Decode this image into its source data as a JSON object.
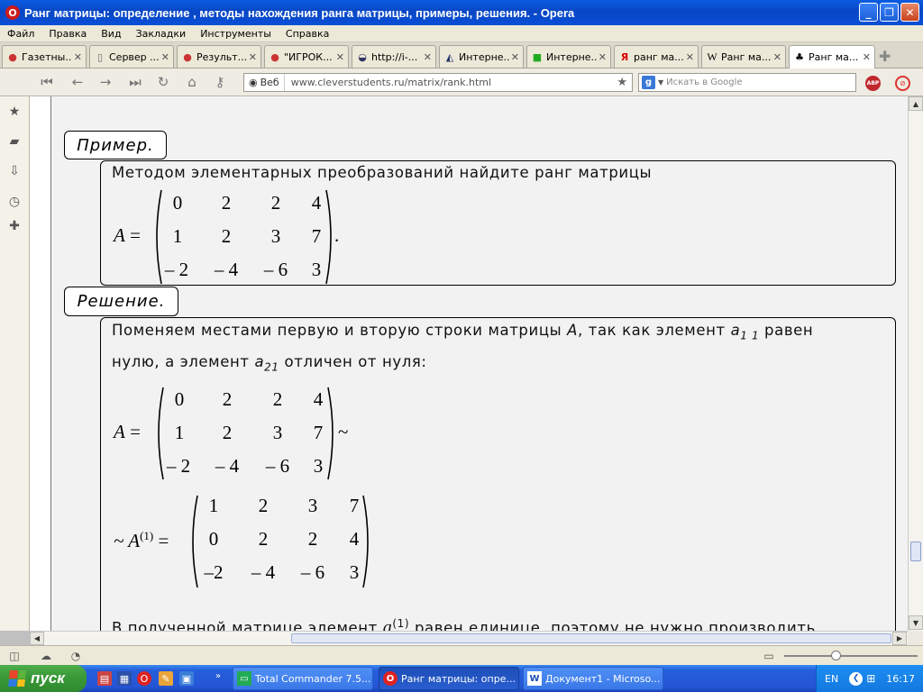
{
  "window": {
    "title": "Ранг матрицы: определение , методы нахождения ранга матрицы, примеры, решения. - Opera"
  },
  "menu": [
    "Файл",
    "Правка",
    "Вид",
    "Закладки",
    "Инструменты",
    "Справка"
  ],
  "tabs": [
    {
      "label": "Газетны...",
      "icon": "opera-icon"
    },
    {
      "label": "Сервер ...",
      "icon": "page-icon"
    },
    {
      "label": "Результ...",
      "icon": "opera-icon"
    },
    {
      "label": "\"ИГРОК...",
      "icon": "opera-icon"
    },
    {
      "label": "http://i-...",
      "icon": "globe-icon"
    },
    {
      "label": "Интерне...",
      "icon": "cap-icon"
    },
    {
      "label": "Интерне...",
      "icon": "green-icon"
    },
    {
      "label": "ранг ма...",
      "icon": "yandex-icon"
    },
    {
      "label": "Ранг ма...",
      "icon": "w-icon"
    },
    {
      "label": "Ранг ма...",
      "icon": "clover-icon"
    }
  ],
  "nav": {
    "veb_label": "Веб",
    "url": "www.cleverstudents.ru/matrix/rank.html",
    "search_placeholder": "Искать в Google",
    "abp": "ABP",
    "search_engine": "g"
  },
  "content": {
    "example_label": "Пример.",
    "example_text": "Методом элементарных преобразований найдите ранг матрицы",
    "solution_label": "Решение.",
    "sol_line1_a": "Поменяем местами первую и вторую строки матрицы",
    "sol_line1_A": "A",
    "sol_line1_b": ", так как элемент",
    "sol_line1_a11": "a",
    "sol_line1_a11_sub": "1 1",
    "sol_line1_c": "равен",
    "sol_line2_a": "нулю, а элемент",
    "sol_line2_a21": "a",
    "sol_line2_a21_sub": "21",
    "sol_line2_b": "отличен от нуля:",
    "matrix_var": "A",
    "matrix_eq": "=",
    "matrix_dot": ".",
    "tilde": "~",
    "matrix_A1_var": "~ A",
    "matrix_A1_sup": "(1)",
    "matrix_A": [
      [
        "0",
        "2",
        "2",
        "4"
      ],
      [
        "1",
        "2",
        "3",
        "7"
      ],
      [
        "– 2",
        "– 4",
        "– 6",
        "3"
      ]
    ],
    "matrix_A1": [
      [
        "1",
        "2",
        "3",
        "7"
      ],
      [
        "0",
        "2",
        "2",
        "4"
      ],
      [
        "–2",
        "– 4",
        "– 6",
        "3"
      ]
    ],
    "bottom_line_a": "В полученной матрице элемент",
    "bottom_line_var": "a",
    "bottom_line_sup": "(1)",
    "bottom_line_b": "равен единице, поэтому не нужно производить"
  },
  "taskbar": {
    "start": "пуск",
    "buttons": [
      "Total Commander 7.5...",
      "Ранг матрицы: опре...",
      "Документ1 - Microso..."
    ],
    "lang": "EN",
    "time": "16:17"
  }
}
